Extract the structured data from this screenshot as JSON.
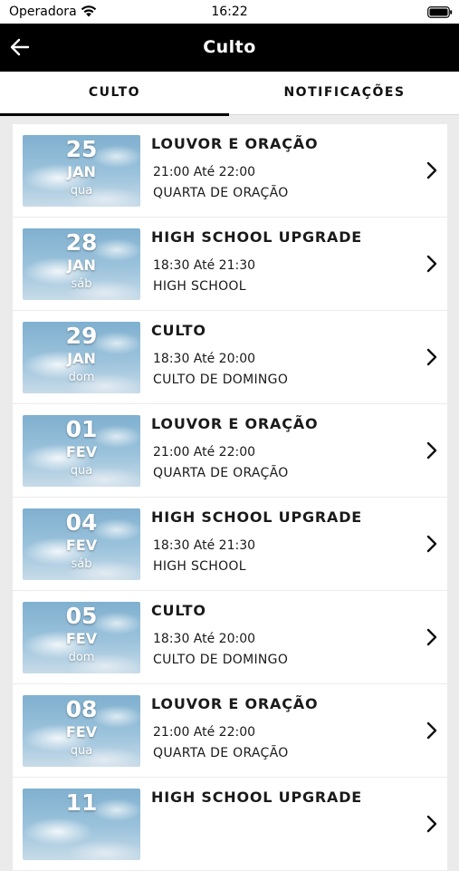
{
  "status_bar": {
    "carrier": "Operadora",
    "time": "16:22"
  },
  "navbar": {
    "title": "Culto"
  },
  "tabs": [
    {
      "label": "CULTO",
      "active": true
    },
    {
      "label": "NOTIFICAÇÕES",
      "active": false
    }
  ],
  "events": [
    {
      "day": "25",
      "month": "JAN",
      "weekday": "qua",
      "title": "LOUVOR E ORAÇÃO",
      "time": "21:00 Até 22:00",
      "type": "QUARTA DE ORAÇÃO"
    },
    {
      "day": "28",
      "month": "JAN",
      "weekday": "sáb",
      "title": "HIGH SCHOOL UPGRADE",
      "time": "18:30 Até 21:30",
      "type": "HIGH SCHOOL"
    },
    {
      "day": "29",
      "month": "JAN",
      "weekday": "dom",
      "title": "CULTO",
      "time": "18:30 Até 20:00",
      "type": "CULTO DE DOMINGO"
    },
    {
      "day": "01",
      "month": "FEV",
      "weekday": "qua",
      "title": "LOUVOR E ORAÇÃO",
      "time": "21:00 Até 22:00",
      "type": "QUARTA DE ORAÇÃO"
    },
    {
      "day": "04",
      "month": "FEV",
      "weekday": "sáb",
      "title": "HIGH SCHOOL UPGRADE",
      "time": "18:30 Até 21:30",
      "type": "HIGH SCHOOL"
    },
    {
      "day": "05",
      "month": "FEV",
      "weekday": "dom",
      "title": "CULTO",
      "time": "18:30 Até 20:00",
      "type": "CULTO DE DOMINGO"
    },
    {
      "day": "08",
      "month": "FEV",
      "weekday": "qua",
      "title": "LOUVOR E ORAÇÃO",
      "time": "21:00 Até 22:00",
      "type": "QUARTA DE ORAÇÃO"
    },
    {
      "day": "11",
      "month": "",
      "weekday": "",
      "title": "HIGH SCHOOL UPGRADE",
      "time": "",
      "type": ""
    }
  ]
}
